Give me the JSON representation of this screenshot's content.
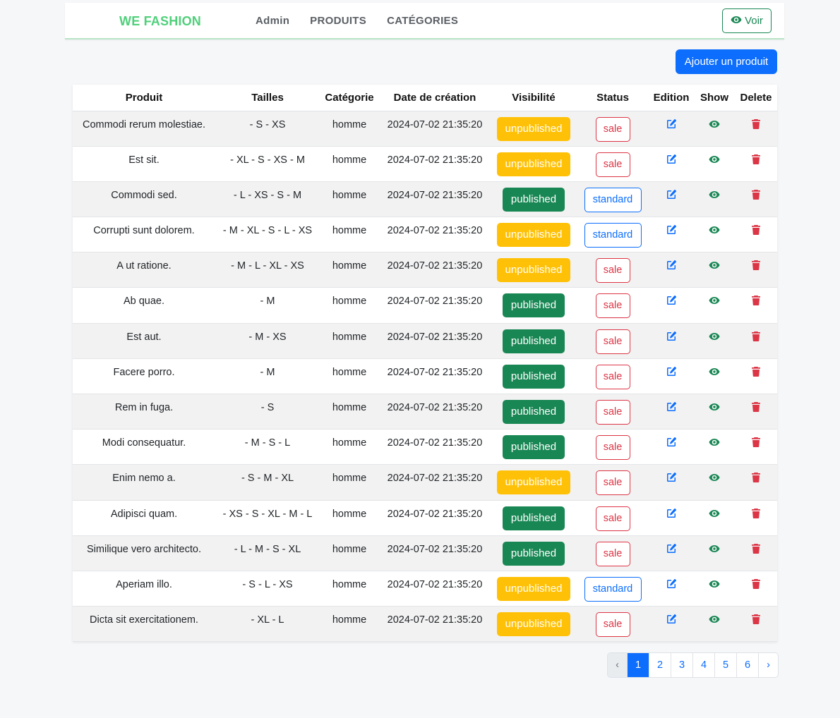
{
  "nav": {
    "brand": "WE FASHION",
    "links": [
      "Admin",
      "PRODUITS",
      "CATÉGORIES"
    ],
    "view_label": "Voir"
  },
  "add_button": "Ajouter un produit",
  "table": {
    "headers": [
      "Produit",
      "Tailles",
      "Catégorie",
      "Date de création",
      "Visibilité",
      "Status",
      "Edition",
      "Show",
      "Delete"
    ],
    "rows": [
      {
        "name": "Commodi rerum molestiae.",
        "sizes": "- S - XS",
        "category": "homme",
        "date": "2024-07-02 21:35:20",
        "visibility": "unpublished",
        "status": "sale"
      },
      {
        "name": "Est sit.",
        "sizes": "- XL - S - XS - M",
        "category": "homme",
        "date": "2024-07-02 21:35:20",
        "visibility": "unpublished",
        "status": "sale"
      },
      {
        "name": "Commodi sed.",
        "sizes": "- L - XS - S - M",
        "category": "homme",
        "date": "2024-07-02 21:35:20",
        "visibility": "published",
        "status": "standard"
      },
      {
        "name": "Corrupti sunt dolorem.",
        "sizes": "- M - XL - S - L - XS",
        "category": "homme",
        "date": "2024-07-02 21:35:20",
        "visibility": "unpublished",
        "status": "standard"
      },
      {
        "name": "A ut ratione.",
        "sizes": "- M - L - XL - XS",
        "category": "homme",
        "date": "2024-07-02 21:35:20",
        "visibility": "unpublished",
        "status": "sale"
      },
      {
        "name": "Ab quae.",
        "sizes": "- M",
        "category": "homme",
        "date": "2024-07-02 21:35:20",
        "visibility": "published",
        "status": "sale"
      },
      {
        "name": "Est aut.",
        "sizes": "- M - XS",
        "category": "homme",
        "date": "2024-07-02 21:35:20",
        "visibility": "published",
        "status": "sale"
      },
      {
        "name": "Facere porro.",
        "sizes": "- M",
        "category": "homme",
        "date": "2024-07-02 21:35:20",
        "visibility": "published",
        "status": "sale"
      },
      {
        "name": "Rem in fuga.",
        "sizes": "- S",
        "category": "homme",
        "date": "2024-07-02 21:35:20",
        "visibility": "published",
        "status": "sale"
      },
      {
        "name": "Modi consequatur.",
        "sizes": "- M - S - L",
        "category": "homme",
        "date": "2024-07-02 21:35:20",
        "visibility": "published",
        "status": "sale"
      },
      {
        "name": "Enim nemo a.",
        "sizes": "- S - M - XL",
        "category": "homme",
        "date": "2024-07-02 21:35:20",
        "visibility": "unpublished",
        "status": "sale"
      },
      {
        "name": "Adipisci quam.",
        "sizes": "- XS - S - XL - M - L",
        "category": "homme",
        "date": "2024-07-02 21:35:20",
        "visibility": "published",
        "status": "sale"
      },
      {
        "name": "Similique vero architecto.",
        "sizes": "- L - M - S - XL",
        "category": "homme",
        "date": "2024-07-02 21:35:20",
        "visibility": "published",
        "status": "sale"
      },
      {
        "name": "Aperiam illo.",
        "sizes": "- S - L - XS",
        "category": "homme",
        "date": "2024-07-02 21:35:20",
        "visibility": "unpublished",
        "status": "standard"
      },
      {
        "name": "Dicta sit exercitationem.",
        "sizes": "- XL - L",
        "category": "homme",
        "date": "2024-07-02 21:35:20",
        "visibility": "unpublished",
        "status": "sale"
      }
    ]
  },
  "pagination": {
    "prev": "‹",
    "pages": [
      "1",
      "2",
      "3",
      "4",
      "5",
      "6"
    ],
    "active": "1",
    "next": "›"
  },
  "icons": {
    "view": "eye-icon",
    "edit": "edit-icon",
    "show": "eye-icon",
    "delete": "trash-icon"
  },
  "colors": {
    "brand": "#4fd07a",
    "primary": "#0d6efd",
    "success": "#198754",
    "warning": "#ffc107",
    "danger": "#dc3545"
  }
}
